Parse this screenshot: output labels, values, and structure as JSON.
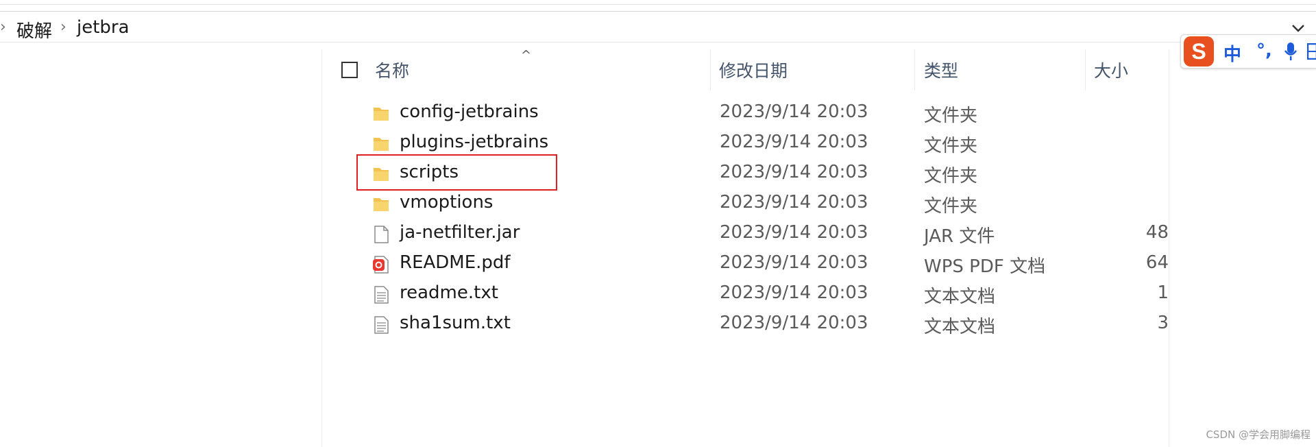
{
  "breadcrumb": {
    "items": [
      "破解",
      "jetbra"
    ]
  },
  "ime_toolbar": {
    "logo": "S",
    "mode": "中",
    "punct": "°,",
    "mic_icon": "microphone-icon",
    "keyboard_icon": "keyboard-icon"
  },
  "columns": {
    "name": "名称",
    "date": "修改日期",
    "type": "类型",
    "size": "大小"
  },
  "files": [
    {
      "name": "config-jetbrains",
      "date": "2023/9/14 20:03",
      "type": "文件夹",
      "size": "",
      "icon": "folder-icon"
    },
    {
      "name": "plugins-jetbrains",
      "date": "2023/9/14 20:03",
      "type": "文件夹",
      "size": "",
      "icon": "folder-icon"
    },
    {
      "name": "scripts",
      "date": "2023/9/14 20:03",
      "type": "文件夹",
      "size": "",
      "icon": "folder-icon"
    },
    {
      "name": "vmoptions",
      "date": "2023/9/14 20:03",
      "type": "文件夹",
      "size": "",
      "icon": "folder-icon"
    },
    {
      "name": "ja-netfilter.jar",
      "date": "2023/9/14 20:03",
      "type": "JAR 文件",
      "size": "48",
      "icon": "file-icon"
    },
    {
      "name": "README.pdf",
      "date": "2023/9/14 20:03",
      "type": "WPS PDF 文档",
      "size": "64",
      "icon": "pdf-icon"
    },
    {
      "name": "readme.txt",
      "date": "2023/9/14 20:03",
      "type": "文本文档",
      "size": "1",
      "icon": "text-file-icon"
    },
    {
      "name": "sha1sum.txt",
      "date": "2023/9/14 20:03",
      "type": "文本文档",
      "size": "3",
      "icon": "text-file-icon"
    }
  ],
  "watermark": "CSDN @学会用脚编程",
  "colors": {
    "highlight": "#e02020",
    "ime_logo": "#e8501f",
    "ime_accent": "#1e5bd8",
    "folder": "#f4c24f"
  }
}
